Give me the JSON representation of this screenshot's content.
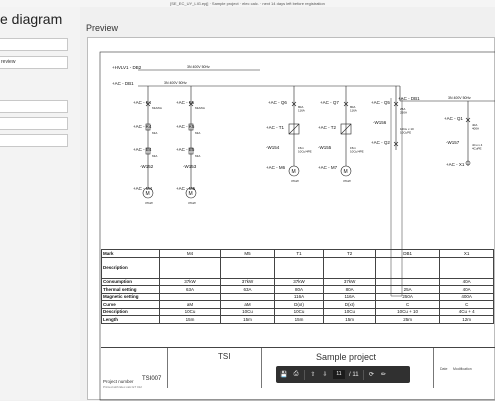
{
  "app": {
    "window_title": "[SE_EC_UY_LIG.epj] · Sample project · elec calc. · next 14 days left before registration"
  },
  "sidebar": {
    "heading": "e diagram",
    "fields": [
      "",
      "review",
      "",
      "",
      "",
      ""
    ]
  },
  "preview": {
    "title": "Preview"
  },
  "diagram": {
    "bus1": "+HVLV1 - DB2",
    "bus1_spec": "3N 400V   50Hz",
    "bus2": "+AC - DB1",
    "bus2_spec": "3N 400V   50Hz",
    "bus3": "+AC - DB1",
    "bus3_spec": "3N 400V   50Hz",
    "feeders": [
      {
        "breaker": "+AC - F4",
        "contactor": "+AC - K4",
        "relay": "+AC - B4",
        "cable": "-W152",
        "load": "+AC - M4",
        "r1": "63A/6A",
        "r2": "63A",
        "r3": "63A",
        "cable_spec": "15m\n10Cu/4PE",
        "motor": "37kW",
        "mark": "M"
      },
      {
        "breaker": "+AC - F5",
        "contactor": "+AC - K5",
        "relay": "+AC - B5",
        "cable": "-W153",
        "load": "+AC - M5",
        "r1": "63A/6A",
        "r2": "63A",
        "r3": "63A",
        "cable_spec": "15m\n10Cu/4PE",
        "motor": "37kW",
        "mark": "M"
      },
      {
        "breaker": "+AC - Q6",
        "drive": "+AC - T1",
        "cable": "-W154",
        "load": "+AC - M6",
        "r1": "80A\n116A",
        "cable_spec": "15m\n10Cu/4PE",
        "motor": "37kW",
        "mark": "M"
      },
      {
        "breaker": "+AC - Q7",
        "drive": "+AC - T2",
        "cable": "-W155",
        "load": "+AC - M7",
        "r1": "80A\n116A",
        "cable_spec": "15m\n10Cu/4PE",
        "motor": "37kW",
        "mark": "M"
      },
      {
        "breaker": "+AC - Q5",
        "cable": "-W156",
        "load": "+AC - Q2",
        "r1": "25A\n250A",
        "cable_spec": "10Cu x 10\n10CuPE",
        "mark": ""
      },
      {
        "breaker": "+AC - Q1",
        "cable": "-W157",
        "load": "+AC - X1",
        "r1": "40A\n400A",
        "cable_spec": "4Cu x 4\n4CuPE",
        "mark": ""
      }
    ]
  },
  "table": {
    "rows": [
      {
        "label": "Mark",
        "values": [
          "M4",
          "M5",
          "T1",
          "T2",
          "DB1",
          "X1"
        ]
      },
      {
        "label": "Description",
        "values": [
          "",
          "",
          "",
          "",
          "",
          ""
        ],
        "tall": true
      },
      {
        "label": "Consumption",
        "values": [
          "37kW",
          "37kW",
          "37kW",
          "37kW",
          "",
          "40A"
        ]
      },
      {
        "label": "Thermal setting",
        "values": [
          "63A",
          "63A",
          "80A",
          "80A",
          "25A",
          "40A"
        ]
      },
      {
        "label": "Magnetic setting",
        "values": [
          "",
          "",
          "116A",
          "116A",
          "250A",
          "400A"
        ]
      },
      {
        "label": "Curve",
        "values": [
          "aM",
          "aM",
          "D(xI)",
          "D(xI)",
          "C",
          "C"
        ]
      },
      {
        "label": "Description",
        "values": [
          "10Cu",
          "10Cu",
          "10Cu",
          "10Cu",
          "10Cu + 10",
          "4Cu + 4"
        ]
      },
      {
        "label": "Length",
        "values": [
          "15m",
          "15m",
          "15m",
          "15m",
          "25m",
          "12m"
        ]
      }
    ]
  },
  "titleblock": {
    "left_title": "TSI",
    "main_title": "Sample project",
    "project_number_label": "Project number",
    "project_number": "TSI007",
    "printed_on": "Printed with   Elec calc   ET 012",
    "col_date": "Date",
    "col_mod": "Modification"
  },
  "pdf_toolbar": {
    "page_current": "11",
    "page_total": "/ 11"
  }
}
